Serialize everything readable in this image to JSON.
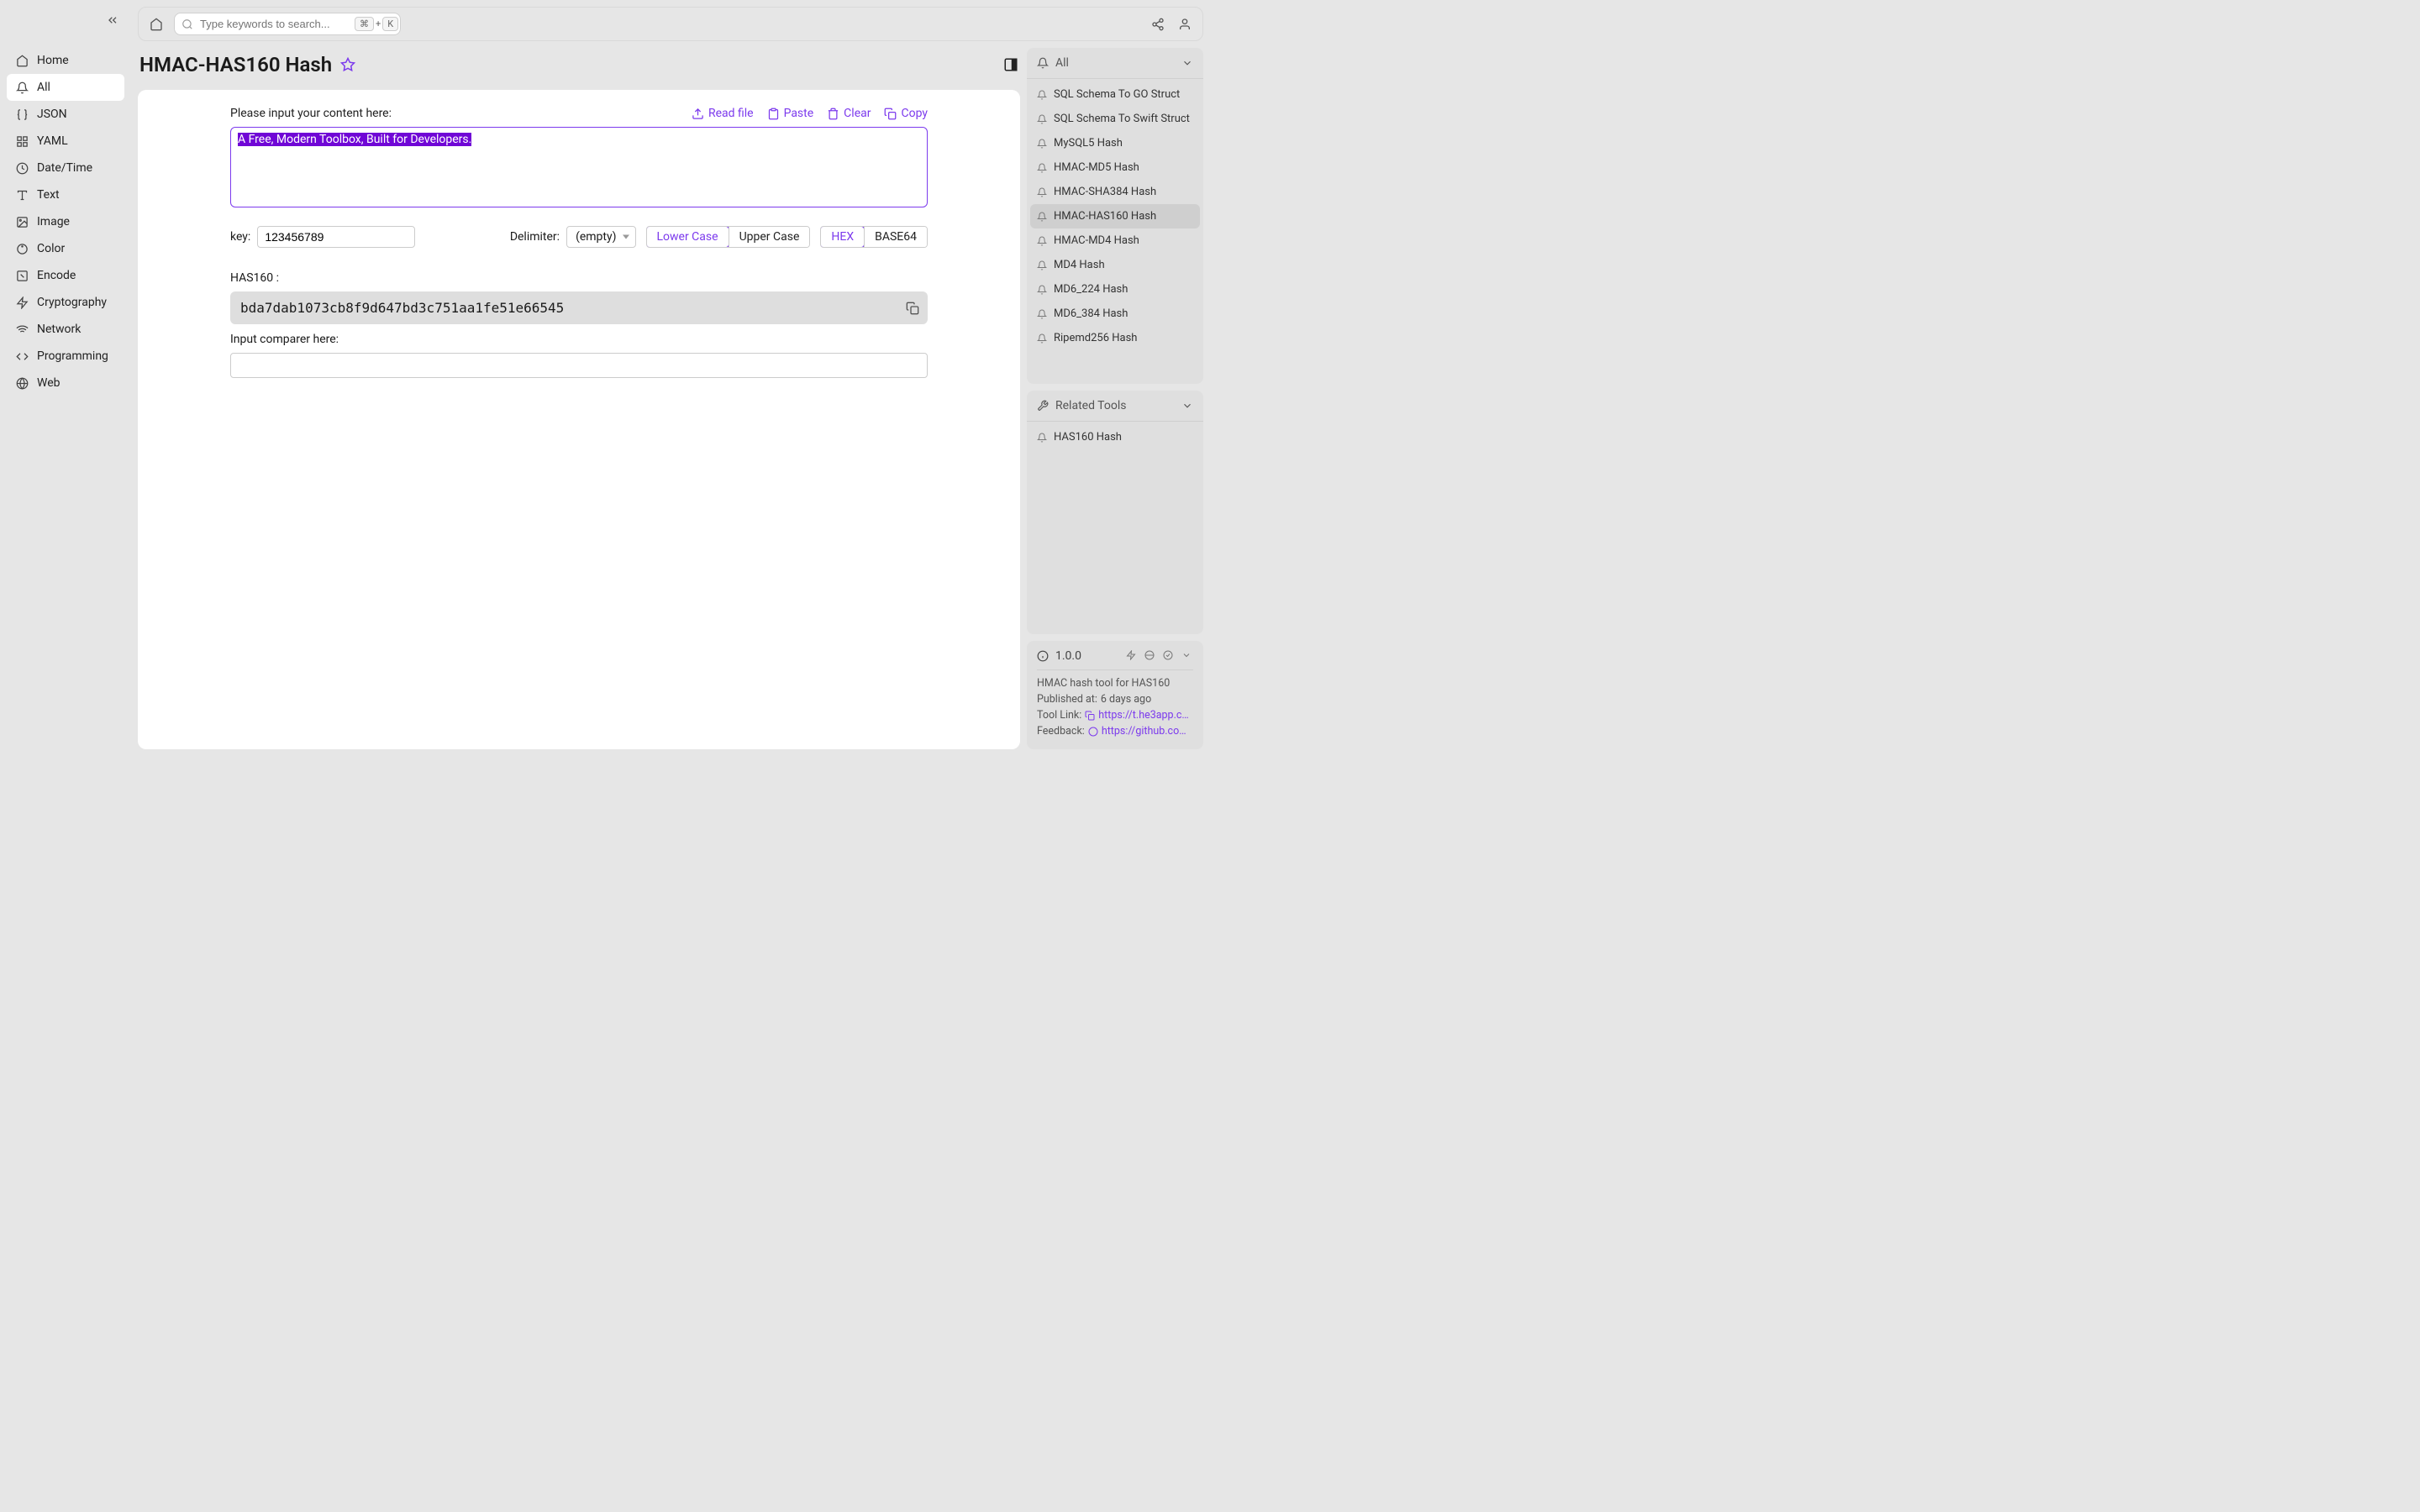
{
  "sidebar": {
    "items": [
      {
        "label": "Home"
      },
      {
        "label": "All"
      },
      {
        "label": "JSON"
      },
      {
        "label": "YAML"
      },
      {
        "label": "Date/Time"
      },
      {
        "label": "Text"
      },
      {
        "label": "Image"
      },
      {
        "label": "Color"
      },
      {
        "label": "Encode"
      },
      {
        "label": "Cryptography"
      },
      {
        "label": "Network"
      },
      {
        "label": "Programming"
      },
      {
        "label": "Web"
      }
    ],
    "active_index": 1
  },
  "topbar": {
    "search_placeholder": "Type keywords to search...",
    "kbd1": "⌘",
    "plus": "+",
    "kbd2": "K"
  },
  "page": {
    "title": "HMAC-HAS160 Hash"
  },
  "tool": {
    "input_label": "Please input your content here:",
    "actions": {
      "read_file": "Read file",
      "paste": "Paste",
      "clear": "Clear",
      "copy": "Copy"
    },
    "input_value": "A Free, Modern Toolbox, Built for Developers.",
    "key_label": "key:",
    "key_value": "123456789",
    "delimiter_label": "Delimiter:",
    "delimiter_value": "(empty)",
    "case": {
      "lower": "Lower Case",
      "upper": "Upper Case"
    },
    "encoding": {
      "hex": "HEX",
      "base64": "BASE64"
    },
    "output_label": "HAS160 :",
    "output_value": "bda7dab1073cb8f9d647bd3c751aa1fe51e66545",
    "comparer_label": "Input comparer here:",
    "comparer_value": ""
  },
  "right": {
    "all": {
      "header": "All",
      "items": [
        "SQL Schema To GO Struct",
        "SQL Schema To Swift Struct",
        "MySQL5 Hash",
        "HMAC-MD5 Hash",
        "HMAC-SHA384 Hash",
        "HMAC-HAS160 Hash",
        "HMAC-MD4 Hash",
        "MD4 Hash",
        "MD6_224 Hash",
        "MD6_384 Hash",
        "Ripemd256 Hash"
      ],
      "active_index": 5
    },
    "related": {
      "header": "Related Tools",
      "items": [
        "HAS160 Hash"
      ]
    },
    "info": {
      "version": "1.0.0",
      "desc": "HMAC hash tool for HAS160",
      "published_label": "Published at:",
      "published_value": "6 days ago",
      "tool_link_label": "Tool Link:",
      "tool_link_value": "https://t.he3app.co…",
      "feedback_label": "Feedback:",
      "feedback_value": "https://github.com/…"
    }
  }
}
